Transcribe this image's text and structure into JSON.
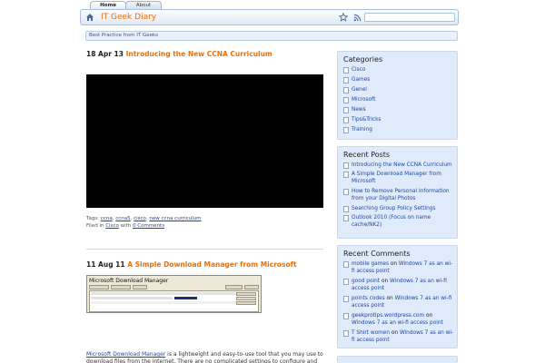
{
  "tabs": [
    {
      "label": "Home",
      "active": true
    },
    {
      "label": "About",
      "active": false
    }
  ],
  "header": {
    "site_title": "IT Geek Diary",
    "search_placeholder": ""
  },
  "tagline": "Best Practice from IT Geeks",
  "posts": [
    {
      "date": "18 Apr 13",
      "title": "Introducing the New CCNA Curriculum",
      "tags_label": "Tags:",
      "tags": [
        "ccna",
        "ccna5",
        "cisco",
        "new ccna curriculum"
      ],
      "filed_label": "Filed in",
      "category": "Cisco",
      "with_label": "with",
      "comments": "0 Comments"
    },
    {
      "date": "11 Aug 11",
      "title": "A Simple Download Manager from Microsoft",
      "screenshot_title": "Microsoft Download Manager",
      "excerpt_link": "Microsoft Download Manager",
      "excerpt_rest": " is a lightweight and easy-to-use tool that you may use to download files from the internet. There are no complicated settings to configure and all you need to do is"
    }
  ],
  "sidebar": {
    "categories": {
      "title": "Categories",
      "items": [
        "Cisco",
        "Games",
        "Genel",
        "Microsoft",
        "News",
        "Tips&Tricks",
        "Training"
      ]
    },
    "recent_posts": {
      "title": "Recent Posts",
      "items": [
        "Introducing the New CCNA Curriculum",
        "A Simple Download Manager from Microsoft",
        "How to Remove Personal Information from your Digital Photos",
        "Searching Group Policy Settings",
        "Outlook 2010 (Focus on name cache/NK2)"
      ]
    },
    "recent_comments": {
      "title": "Recent Comments",
      "on_label": "on",
      "items": [
        {
          "author": "mobile games",
          "post": "Windows 7 as an wi-fi access point"
        },
        {
          "author": "good point",
          "post": "Windows 7 as an wi-fi access point"
        },
        {
          "author": "points codes",
          "post": "Windows 7 as an wi-fi access point"
        },
        {
          "author": "geekprotips.wordpress.com",
          "post": "Windows 7 as an wi-fi access point"
        },
        {
          "author": "T Shirt women",
          "post": "Windows 7 as an wi-fi access point"
        }
      ]
    }
  },
  "colors": {
    "accent": "#e5700f",
    "link": "#1e47a3",
    "sidebar_bg": "#dfeafb"
  },
  "icons": {
    "home": "home-icon",
    "star": "star-icon",
    "rss": "rss-icon",
    "page": "page-icon"
  }
}
